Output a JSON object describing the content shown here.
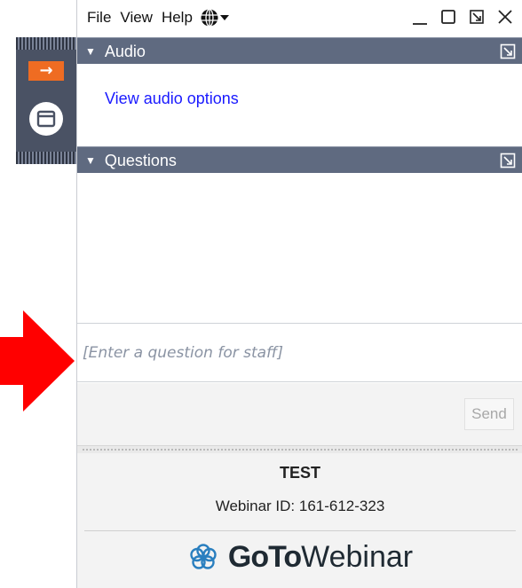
{
  "menu": {
    "file": "File",
    "view": "View",
    "help": "Help"
  },
  "icons": {
    "language": "globe-icon",
    "minimize": "minimize-icon",
    "restore": "restore-icon",
    "popout": "popout-icon",
    "close": "close-icon",
    "collapse": "arrow-right-icon",
    "window": "window-icon",
    "annotation": "red-arrow-icon",
    "brand_logo": "gotowebinar-flower-icon"
  },
  "audio": {
    "header": "Audio",
    "link": "View audio options"
  },
  "questions": {
    "header": "Questions",
    "input_placeholder": "[Enter a question for staff]",
    "send_label": "Send"
  },
  "webinar": {
    "title": "TEST",
    "id_text": "Webinar ID: 161-612-323"
  },
  "brand": {
    "strong": "GoTo",
    "light": "Webinar"
  },
  "colors": {
    "section_header": "#5f6a80",
    "grab_bar": "#4a5264",
    "collapse_accent": "#ef6c22",
    "link": "#1a1aff",
    "annotation_arrow": "#ff0000",
    "brand_logo": "#2a7fbf"
  }
}
